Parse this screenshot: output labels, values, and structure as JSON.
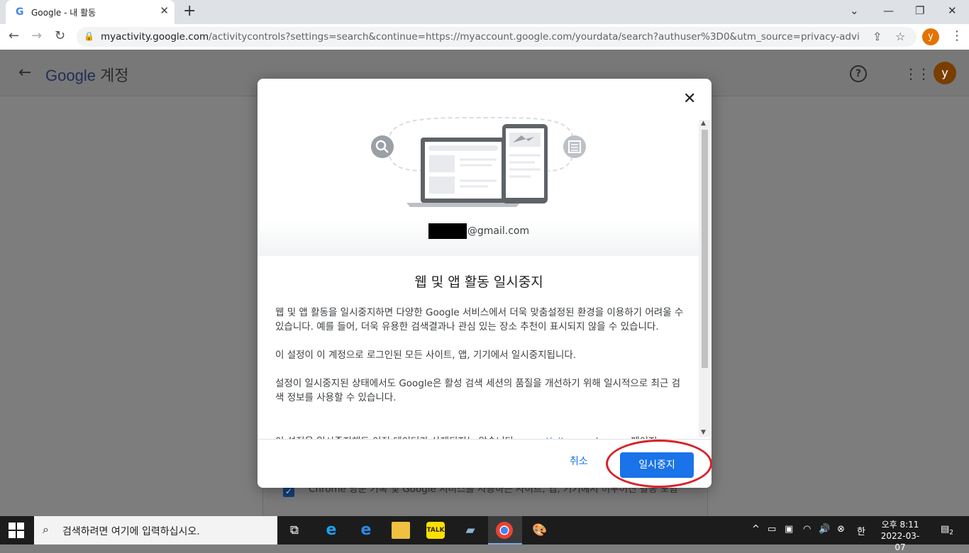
{
  "browser": {
    "tab_title": "Google - 내 활동",
    "url_host": "myactivity.google.com",
    "url_rest": "/activitycontrols?settings=search&continue=https://myaccount.google.com/yourdata/search?authuser%3D0&utm_source=privacy-advisor-search...",
    "profile_initial": "y"
  },
  "appbar": {
    "logo": "Google",
    "product": "계정",
    "avatar_initial": "y"
  },
  "background_card": {
    "checkbox_text": "Chrome 방문 기록 및 Google 서비스를 사용하는 사이트, 앱, 기기에서 이루어진 활동 포함"
  },
  "dialog": {
    "email_suffix": "@gmail.com",
    "title": "웹 및 앱 활동 일시중지",
    "paragraphs": [
      "웹 및 앱 활동을 일시중지하면 다양한 Google 서비스에서 더욱 맞춤설정된 환경을 이용하기 어려울 수 있습니다. 예를 들어, 더욱 유용한 검색결과나 관심 있는 장소 추천이 표시되지 않을 수 있습니다.",
      "이 설정이 이 계정으로 로그인된 모든 사이트, 앱, 기기에서 일시중지됩니다.",
      "설정이 일시중지된 상태에서도 Google은 활성 검색 세션의 품질을 개선하기 위해 일시적으로 최근 검색 정보를 사용할 수 있습니다."
    ],
    "clipped_line_start": "이 설정을 일시중지해도 이전 데이터가 삭제되지는 않습니다. ",
    "clipped_link": "myactivity.google.com",
    "clipped_line_end": " 페이지",
    "cancel_label": "취소",
    "pause_label": "일시중지"
  },
  "taskbar": {
    "search_placeholder": "검색하려면 여기에 입력하십시오.",
    "ime": "한",
    "time": "오후 8:11",
    "date": "2022-03-07",
    "notification_count": "2"
  },
  "colors": {
    "accent": "#1a73e8",
    "highlight_annotation": "#d8222a"
  }
}
